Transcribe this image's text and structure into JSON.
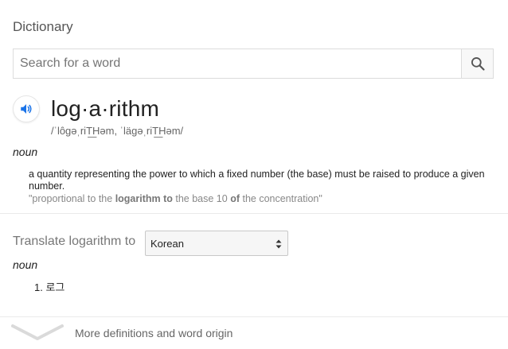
{
  "header": {
    "title": "Dictionary"
  },
  "search": {
    "placeholder": "Search for a word",
    "value": ""
  },
  "entry": {
    "headword": "log·a·rithm",
    "phonetic": "/ˈlôɡəˌriT͟Həm, ˈläɡəˌriT͟Həm/",
    "pos": "noun",
    "definition": "a quantity representing the power to which a fixed number (the base) must be raised to produce a given number.",
    "example_pre": "\"proportional to the ",
    "example_bold": "logarithm to",
    "example_mid": " the base 10 ",
    "example_bold2": "of",
    "example_post": " the concentration\""
  },
  "translate": {
    "label": "Translate logarithm to",
    "selected_language": "Korean",
    "pos": "noun",
    "results": [
      {
        "number": "1.",
        "text": "로그"
      }
    ]
  },
  "footer": {
    "more_label": "More definitions and word origin"
  },
  "colors": {
    "accent_blue": "#1a73e8",
    "muted_text": "#777777",
    "divider": "#eaeaea"
  }
}
